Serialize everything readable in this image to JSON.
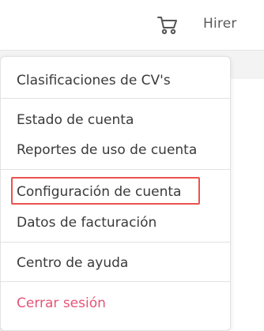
{
  "header": {
    "cart_icon": "shopping-cart-icon",
    "user_name": "Hirer"
  },
  "menu": {
    "items": [
      {
        "label": "Clasificaciones de CV's"
      },
      {
        "label": "Estado de cuenta"
      },
      {
        "label": "Reportes de uso de cuenta"
      },
      {
        "label": "Configuración de cuenta"
      },
      {
        "label": "Datos de facturación"
      },
      {
        "label": "Centro de ayuda"
      },
      {
        "label": "Cerrar sesión"
      }
    ]
  },
  "colors": {
    "logout": "#e55477",
    "highlight_border": "#e8534f"
  }
}
